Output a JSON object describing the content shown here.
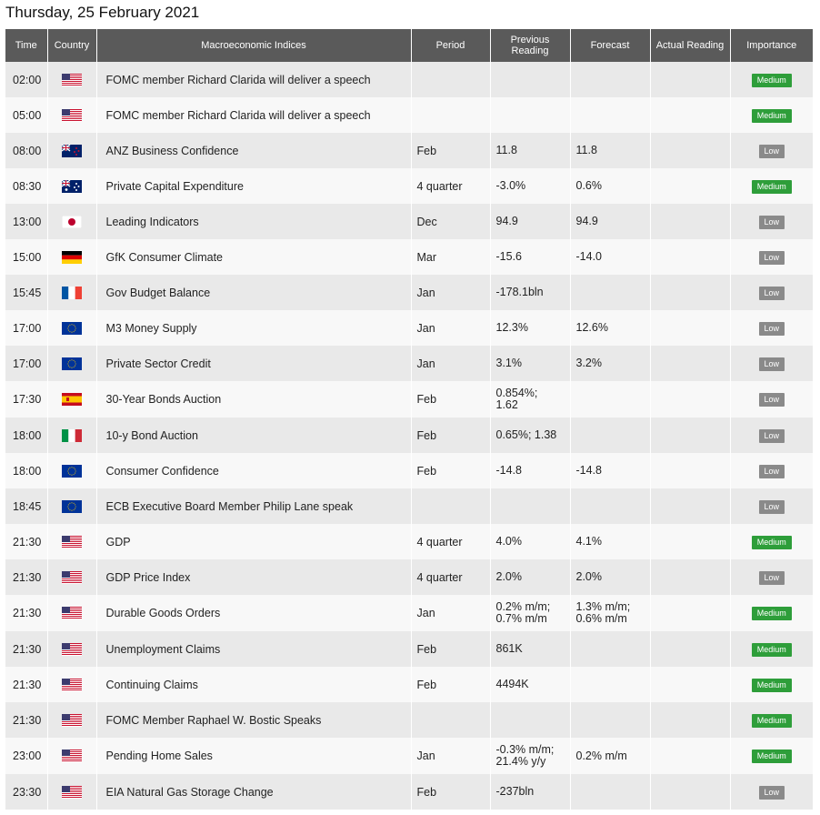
{
  "page_title": "Thursday, 25 February 2021",
  "columns": {
    "time": "Time",
    "country": "Country",
    "indices": "Macroeconomic Indices",
    "period": "Period",
    "previous": "Previous Reading",
    "forecast": "Forecast",
    "actual": "Actual Reading",
    "importance": "Importance"
  },
  "colors": {
    "header_bg": "#5a5a5a",
    "row_odd": "#e9e9e9",
    "row_even": "#f8f8f8",
    "medium_badge": "#2e9e3a",
    "low_badge": "#8a8a8a"
  },
  "rows": [
    {
      "time": "02:00",
      "flag": "us-flag",
      "index": "FOMC member Richard Clarida will deliver a speech",
      "period": "",
      "previous": "",
      "forecast": "",
      "actual": "",
      "importance": "Medium"
    },
    {
      "time": "05:00",
      "flag": "us-flag",
      "index": "FOMC member Richard Clarida will deliver a speech",
      "period": "",
      "previous": "",
      "forecast": "",
      "actual": "",
      "importance": "Medium"
    },
    {
      "time": "08:00",
      "flag": "nz-flag",
      "index": "ANZ Business Confidence",
      "period": "Feb",
      "previous": "11.8",
      "forecast": "11.8",
      "actual": "",
      "importance": "Low"
    },
    {
      "time": "08:30",
      "flag": "au-flag",
      "index": "Private Capital Expenditure",
      "period": "4 quarter",
      "previous": "-3.0%",
      "forecast": "0.6%",
      "actual": "",
      "importance": "Medium"
    },
    {
      "time": "13:00",
      "flag": "jp-flag",
      "index": "Leading Indicators",
      "period": "Dec",
      "previous": "94.9",
      "forecast": "94.9",
      "actual": "",
      "importance": "Low"
    },
    {
      "time": "15:00",
      "flag": "de-flag",
      "index": "GfK Consumer Climate",
      "period": "Mar",
      "previous": "-15.6",
      "forecast": "-14.0",
      "actual": "",
      "importance": "Low"
    },
    {
      "time": "15:45",
      "flag": "fr-flag",
      "index": "Gov Budget Balance",
      "period": "Jan",
      "previous": "-178.1bln",
      "forecast": "",
      "actual": "",
      "importance": "Low"
    },
    {
      "time": "17:00",
      "flag": "eu-flag",
      "index": "M3 Money Supply",
      "period": "Jan",
      "previous": "12.3%",
      "forecast": "12.6%",
      "actual": "",
      "importance": "Low"
    },
    {
      "time": "17:00",
      "flag": "eu-flag",
      "index": "Private Sector Credit",
      "period": "Jan",
      "previous": "3.1%",
      "forecast": "3.2%",
      "actual": "",
      "importance": "Low"
    },
    {
      "time": "17:30",
      "flag": "es-flag",
      "index": "30-Year Bonds Auction",
      "period": "Feb",
      "previous": "0.854%;\n1.62",
      "forecast": "",
      "actual": "",
      "importance": "Low"
    },
    {
      "time": "18:00",
      "flag": "it-flag",
      "index": "10-y Bond Auction",
      "period": "Feb",
      "previous": "0.65%; 1.38",
      "forecast": "",
      "actual": "",
      "importance": "Low"
    },
    {
      "time": "18:00",
      "flag": "eu-flag",
      "index": "Consumer Confidence",
      "period": "Feb",
      "previous": "-14.8",
      "forecast": "-14.8",
      "actual": "",
      "importance": "Low"
    },
    {
      "time": "18:45",
      "flag": "eu-flag",
      "index": "ECB Executive Board Member Philip Lane speak",
      "period": "",
      "previous": "",
      "forecast": "",
      "actual": "",
      "importance": "Low"
    },
    {
      "time": "21:30",
      "flag": "us-flag",
      "index": "GDP",
      "period": "4 quarter",
      "previous": "4.0%",
      "forecast": "4.1%",
      "actual": "",
      "importance": "Medium"
    },
    {
      "time": "21:30",
      "flag": "us-flag",
      "index": "GDP Price Index",
      "period": "4 quarter",
      "previous": "2.0%",
      "forecast": "2.0%",
      "actual": "",
      "importance": "Low"
    },
    {
      "time": "21:30",
      "flag": "us-flag",
      "index": "Durable Goods Orders",
      "period": "Jan",
      "previous": "0.2% m/m;\n0.7% m/m",
      "forecast": "1.3% m/m;\n0.6% m/m",
      "actual": "",
      "importance": "Medium"
    },
    {
      "time": "21:30",
      "flag": "us-flag",
      "index": "Unemployment Claims",
      "period": "Feb",
      "previous": "861K",
      "forecast": "",
      "actual": "",
      "importance": "Medium"
    },
    {
      "time": "21:30",
      "flag": "us-flag",
      "index": "Continuing Claims",
      "period": "Feb",
      "previous": "4494K",
      "forecast": "",
      "actual": "",
      "importance": "Medium"
    },
    {
      "time": "21:30",
      "flag": "us-flag",
      "index": "FOMC Member Raphael W. Bostic Speaks",
      "period": "",
      "previous": "",
      "forecast": "",
      "actual": "",
      "importance": "Medium"
    },
    {
      "time": "23:00",
      "flag": "us-flag",
      "index": "Pending Home Sales",
      "period": "Jan",
      "previous": "-0.3% m/m;\n21.4% y/y",
      "forecast": "0.2% m/m",
      "actual": "",
      "importance": "Medium"
    },
    {
      "time": "23:30",
      "flag": "us-flag",
      "index": "EIA Natural Gas Storage Change",
      "period": "Feb",
      "previous": "-237bln",
      "forecast": "",
      "actual": "",
      "importance": "Low"
    }
  ]
}
